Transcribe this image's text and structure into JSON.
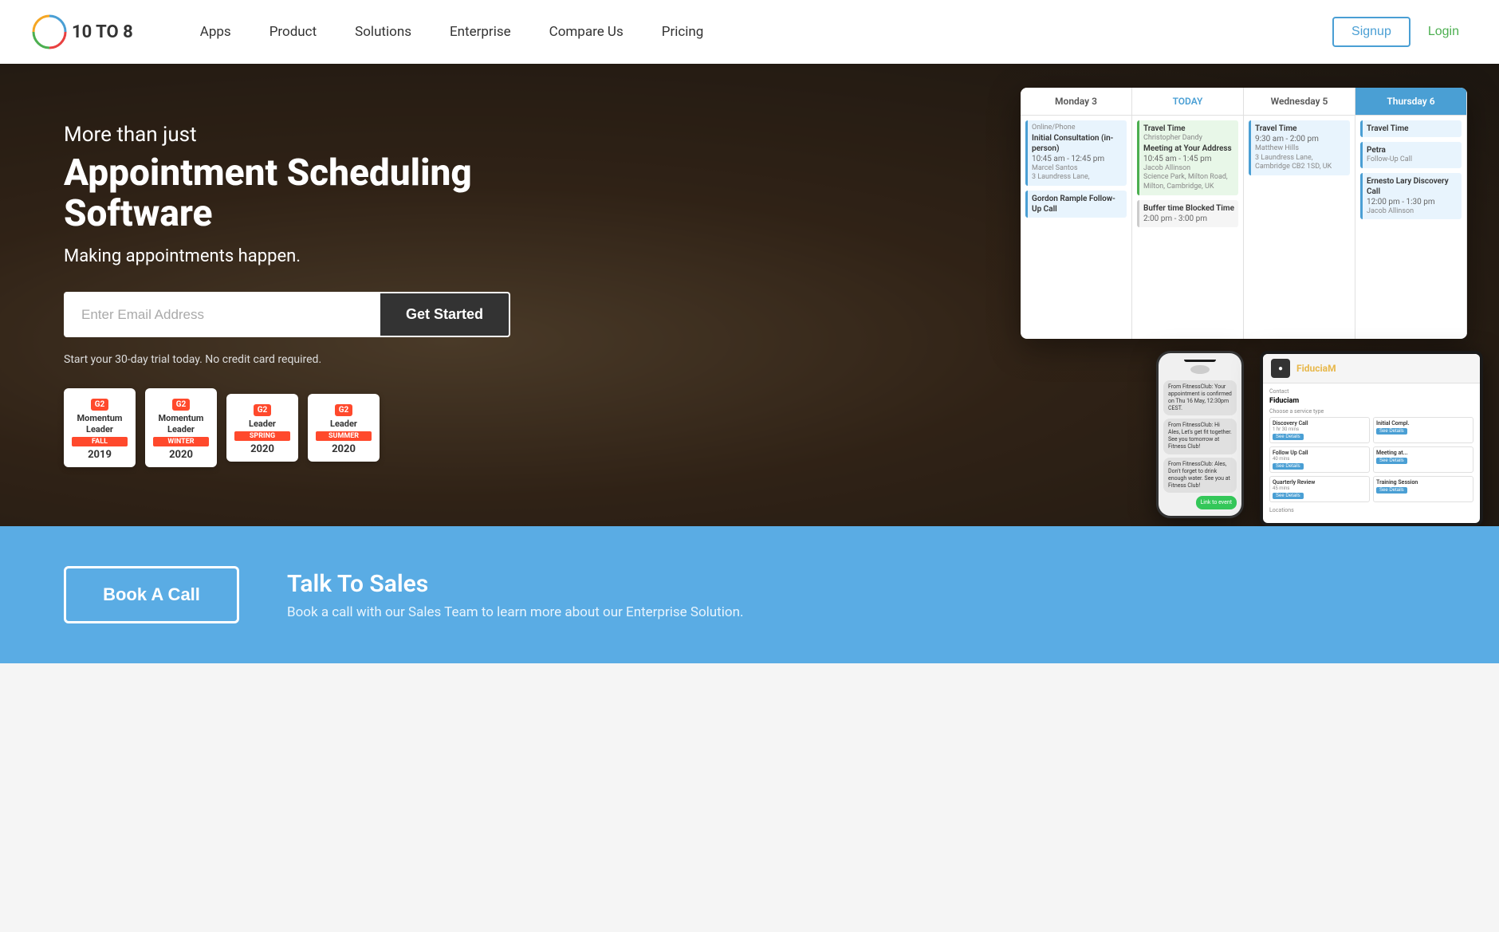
{
  "navbar": {
    "logo_text": "10 TO 8",
    "nav_items": [
      {
        "label": "Apps",
        "id": "apps"
      },
      {
        "label": "Product",
        "id": "product"
      },
      {
        "label": "Solutions",
        "id": "solutions"
      },
      {
        "label": "Enterprise",
        "id": "enterprise"
      },
      {
        "label": "Compare Us",
        "id": "compare-us"
      },
      {
        "label": "Pricing",
        "id": "pricing"
      }
    ],
    "signup_label": "Signup",
    "login_label": "Login"
  },
  "hero": {
    "subtitle": "More than just",
    "title": "Appointment Scheduling Software",
    "description": "Making appointments happen.",
    "email_placeholder": "Enter Email Address",
    "get_started_label": "Get Started",
    "trial_text": "Start your 30-day trial today. No credit card required.",
    "badges": [
      {
        "g2": "G2",
        "title": "Momentum\nLeader",
        "season": "FALL",
        "year": "2019"
      },
      {
        "g2": "G2",
        "title": "Momentum\nLeader",
        "season": "WINTER",
        "year": "2020"
      },
      {
        "g2": "G2",
        "title": "Leader",
        "season": "SPRING",
        "year": "2020"
      },
      {
        "g2": "G2",
        "title": "Leader",
        "season": "SUMMER",
        "year": "2020"
      }
    ]
  },
  "calendar": {
    "days": [
      {
        "label": "Monday 3",
        "type": "normal"
      },
      {
        "label": "TODAY",
        "type": "today"
      },
      {
        "label": "Wednesday 5",
        "type": "normal"
      },
      {
        "label": "Thursday 6",
        "type": "thu"
      }
    ],
    "events": {
      "mon": [
        {
          "title": "Initial Consultation (in-person)",
          "time": "10:45 am - 12:45 pm",
          "person": "Marcel Santos",
          "loc": "3 Laundress Lane,"
        },
        {
          "title": "Gordon Rample Follow-Up Call",
          "time": "",
          "person": "",
          "loc": ""
        }
      ],
      "today": [
        {
          "title": "Travel Time",
          "time": "Christopher Dandy",
          "person": "Meeting at Your Address",
          "loc": "10:45 am - 1:45 pm"
        },
        {
          "title": "Jacob Allinson",
          "time": "Science Park, Milton Road, Milton, Cambridge, UK",
          "person": "",
          "loc": ""
        },
        {
          "title": "Buffer time Blocked Time",
          "time": "2:00 pm - 3:00 pm",
          "person": "",
          "loc": ""
        }
      ],
      "wed": [
        {
          "title": "Travel Time",
          "time": "9:30 am - 2:00 pm",
          "person": "Matthew Hills",
          "loc": "3 Laundress Lane, Cambridge CB2 1SD, UK"
        }
      ],
      "thu": [
        {
          "title": "Travel Time",
          "time": "",
          "person": "",
          "loc": ""
        },
        {
          "title": "Petra Follow-Up Call",
          "time": "",
          "person": "",
          "loc": ""
        },
        {
          "title": "Ernesto Lary Discovery Call",
          "time": "12:00 pm - 1:30 pm",
          "person": "Jacob Allinson",
          "loc": ""
        }
      ]
    }
  },
  "phone": {
    "messages": [
      {
        "text": "From FitnessClub: Your appointment is confirmed on Thu 16 May, 12:30pm CEST.",
        "sent": false
      },
      {
        "text": "From FitnessClub: Hi Ales, Let's get fit together. See you tomorrow at Fitness Club!",
        "sent": false
      },
      {
        "text": "From FitnessClub: Ales, Don't forget to drink enough water. See you at Fitness Club!",
        "sent": false
      },
      {
        "text": "Link to event",
        "sent": true
      }
    ]
  },
  "tablet": {
    "logo_icon": "●",
    "brand_name_1": "Fiducia",
    "brand_name_2": "M",
    "contact_label": "Contact",
    "contact_name": "Fiduciam",
    "service_type_label": "Choose a service type",
    "services": [
      {
        "name": "Discovery Call",
        "time": "1 hr 30 mins",
        "btn": "See Details"
      },
      {
        "name": "Initial Compl.",
        "time": "",
        "btn": "See Details"
      },
      {
        "name": "Follow Up Call",
        "time": "40 mins",
        "btn": "See Details"
      },
      {
        "name": "Meeting at...",
        "time": "",
        "btn": "See Details"
      },
      {
        "name": "Quarterly Review",
        "time": "45 mins",
        "btn": "See Details"
      },
      {
        "name": "Training Session",
        "time": "",
        "btn": "See Details"
      }
    ],
    "locations_label": "Locations"
  },
  "cta": {
    "book_call_label": "Book A Call",
    "talk_to_sales_title": "Talk To Sales",
    "talk_to_sales_desc": "Book a call with our Sales Team to learn more about our Enterprise Solution."
  }
}
